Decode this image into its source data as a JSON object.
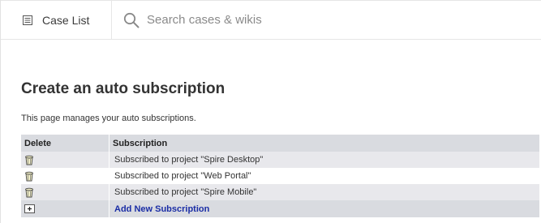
{
  "topbar": {
    "case_list_label": "Case List",
    "case_list_icon": "list-icon",
    "search_icon": "search-icon",
    "search_placeholder": "Search cases & wikis",
    "search_value": ""
  },
  "main": {
    "heading": "Create an auto subscription",
    "description": "This page manages your auto subscriptions.",
    "table": {
      "columns": [
        "Delete",
        "Subscription"
      ],
      "rows": [
        {
          "delete_icon": "trash-icon",
          "subscription": "Subscribed to project \"Spire Desktop\""
        },
        {
          "delete_icon": "trash-icon",
          "subscription": "Subscribed to project \"Web Portal\""
        },
        {
          "delete_icon": "trash-icon",
          "subscription": "Subscribed to project \"Spire Mobile\""
        }
      ],
      "add_icon": "plus-box-icon",
      "add_label": "Add New Subscription"
    }
  },
  "colors": {
    "header_bg": "#d9dbe0",
    "row_odd_bg": "#e8e8ec",
    "link": "#1a2da5"
  }
}
